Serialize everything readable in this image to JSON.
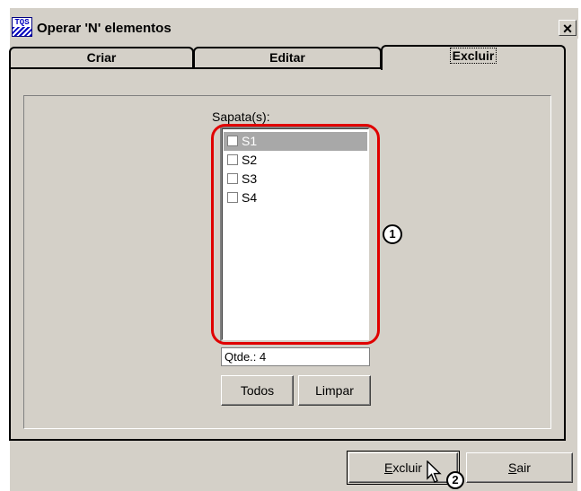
{
  "window": {
    "title": "Operar 'N' elementos",
    "app_icon": "TQS",
    "close_glyph": "×"
  },
  "tabs": [
    {
      "label": "Criar",
      "active": false
    },
    {
      "label": "Editar",
      "active": false
    },
    {
      "label": "Excluir",
      "active": true
    }
  ],
  "list": {
    "label": "Sapata(s):",
    "items": [
      {
        "label": "S1",
        "checked": false,
        "selected": true
      },
      {
        "label": "S2",
        "checked": false,
        "selected": false
      },
      {
        "label": "S3",
        "checked": false,
        "selected": false
      },
      {
        "label": "S4",
        "checked": false,
        "selected": false
      }
    ]
  },
  "count_text": "Qtde.: 4",
  "buttons": {
    "todos": "Todos",
    "limpar": "Limpar",
    "excluir_accel": "E",
    "excluir_rest": "xcluir",
    "sair_accel": "S",
    "sair_rest": "air"
  },
  "annotations": {
    "callout1": "1",
    "callout2": "2"
  },
  "colors": {
    "highlight": "#e00000",
    "dialog_bg": "#d4d0c8",
    "selection_bg": "#a8a8a8"
  }
}
